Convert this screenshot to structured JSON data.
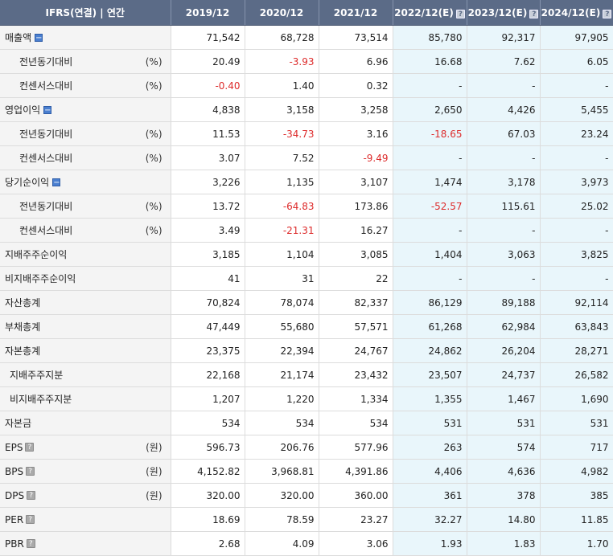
{
  "header": {
    "title": "IFRS(연결) | 연간",
    "columns": [
      "2019/12",
      "2020/12",
      "2021/12",
      "2022/12(E)",
      "2023/12(E)",
      "2024/12(E)"
    ],
    "estimate_help_icon": "help-icon"
  },
  "rows": [
    {
      "label": "매출액",
      "indent": 0,
      "unit": "",
      "toggle": true,
      "help": false,
      "values": [
        "71,542",
        "68,728",
        "73,514",
        "85,780",
        "92,317",
        "97,905"
      ]
    },
    {
      "label": "전년동기대비",
      "indent": 2,
      "unit": "(%)",
      "toggle": false,
      "help": false,
      "values": [
        "20.49",
        "-3.93",
        "6.96",
        "16.68",
        "7.62",
        "6.05"
      ]
    },
    {
      "label": "컨센서스대비",
      "indent": 2,
      "unit": "(%)",
      "toggle": false,
      "help": false,
      "values": [
        "-0.40",
        "1.40",
        "0.32",
        "-",
        "-",
        "-"
      ]
    },
    {
      "label": "영업이익",
      "indent": 0,
      "unit": "",
      "toggle": true,
      "help": false,
      "values": [
        "4,838",
        "3,158",
        "3,258",
        "2,650",
        "4,426",
        "5,455"
      ]
    },
    {
      "label": "전년동기대비",
      "indent": 2,
      "unit": "(%)",
      "toggle": false,
      "help": false,
      "values": [
        "11.53",
        "-34.73",
        "3.16",
        "-18.65",
        "67.03",
        "23.24"
      ]
    },
    {
      "label": "컨센서스대비",
      "indent": 2,
      "unit": "(%)",
      "toggle": false,
      "help": false,
      "values": [
        "3.07",
        "7.52",
        "-9.49",
        "-",
        "-",
        "-"
      ]
    },
    {
      "label": "당기순이익",
      "indent": 0,
      "unit": "",
      "toggle": true,
      "help": false,
      "values": [
        "3,226",
        "1,135",
        "3,107",
        "1,474",
        "3,178",
        "3,973"
      ]
    },
    {
      "label": "전년동기대비",
      "indent": 2,
      "unit": "(%)",
      "toggle": false,
      "help": false,
      "values": [
        "13.72",
        "-64.83",
        "173.86",
        "-52.57",
        "115.61",
        "25.02"
      ]
    },
    {
      "label": "컨센서스대비",
      "indent": 2,
      "unit": "(%)",
      "toggle": false,
      "help": false,
      "values": [
        "3.49",
        "-21.31",
        "16.27",
        "-",
        "-",
        "-"
      ]
    },
    {
      "label": "지배주주순이익",
      "indent": 0,
      "unit": "",
      "toggle": false,
      "help": false,
      "values": [
        "3,185",
        "1,104",
        "3,085",
        "1,404",
        "3,063",
        "3,825"
      ]
    },
    {
      "label": "비지배주주순이익",
      "indent": 0,
      "unit": "",
      "toggle": false,
      "help": false,
      "values": [
        "41",
        "31",
        "22",
        "-",
        "-",
        "-"
      ]
    },
    {
      "label": "자산총계",
      "indent": 0,
      "unit": "",
      "toggle": false,
      "help": false,
      "values": [
        "70,824",
        "78,074",
        "82,337",
        "86,129",
        "89,188",
        "92,114"
      ]
    },
    {
      "label": "부채총계",
      "indent": 0,
      "unit": "",
      "toggle": false,
      "help": false,
      "values": [
        "47,449",
        "55,680",
        "57,571",
        "61,268",
        "62,984",
        "63,843"
      ]
    },
    {
      "label": "자본총계",
      "indent": 0,
      "unit": "",
      "toggle": false,
      "help": false,
      "values": [
        "23,375",
        "22,394",
        "24,767",
        "24,862",
        "26,204",
        "28,271"
      ]
    },
    {
      "label": "지배주주지분",
      "indent": 1,
      "unit": "",
      "toggle": false,
      "help": false,
      "values": [
        "22,168",
        "21,174",
        "23,432",
        "23,507",
        "24,737",
        "26,582"
      ]
    },
    {
      "label": "비지배주주지분",
      "indent": 1,
      "unit": "",
      "toggle": false,
      "help": false,
      "values": [
        "1,207",
        "1,220",
        "1,334",
        "1,355",
        "1,467",
        "1,690"
      ]
    },
    {
      "label": "자본금",
      "indent": 0,
      "unit": "",
      "toggle": false,
      "help": false,
      "values": [
        "534",
        "534",
        "534",
        "531",
        "531",
        "531"
      ]
    },
    {
      "label": "EPS",
      "indent": 0,
      "unit": "(원)",
      "toggle": false,
      "help": true,
      "values": [
        "596.73",
        "206.76",
        "577.96",
        "263",
        "574",
        "717"
      ]
    },
    {
      "label": "BPS",
      "indent": 0,
      "unit": "(원)",
      "toggle": false,
      "help": true,
      "values": [
        "4,152.82",
        "3,968.81",
        "4,391.86",
        "4,406",
        "4,636",
        "4,982"
      ]
    },
    {
      "label": "DPS",
      "indent": 0,
      "unit": "(원)",
      "toggle": false,
      "help": true,
      "values": [
        "320.00",
        "320.00",
        "360.00",
        "361",
        "378",
        "385"
      ]
    },
    {
      "label": "PER",
      "indent": 0,
      "unit": "",
      "toggle": false,
      "help": true,
      "values": [
        "18.69",
        "78.59",
        "23.27",
        "32.27",
        "14.80",
        "11.85"
      ]
    },
    {
      "label": "PBR",
      "indent": 0,
      "unit": "",
      "toggle": false,
      "help": true,
      "values": [
        "2.68",
        "4.09",
        "3.06",
        "1.93",
        "1.83",
        "1.70"
      ]
    }
  ],
  "colors": {
    "header_bg": "#5b6b87",
    "label_bg": "#f4f4f4",
    "estimate_bg": "#e9f6fb",
    "negative": "#dd2b2b"
  }
}
